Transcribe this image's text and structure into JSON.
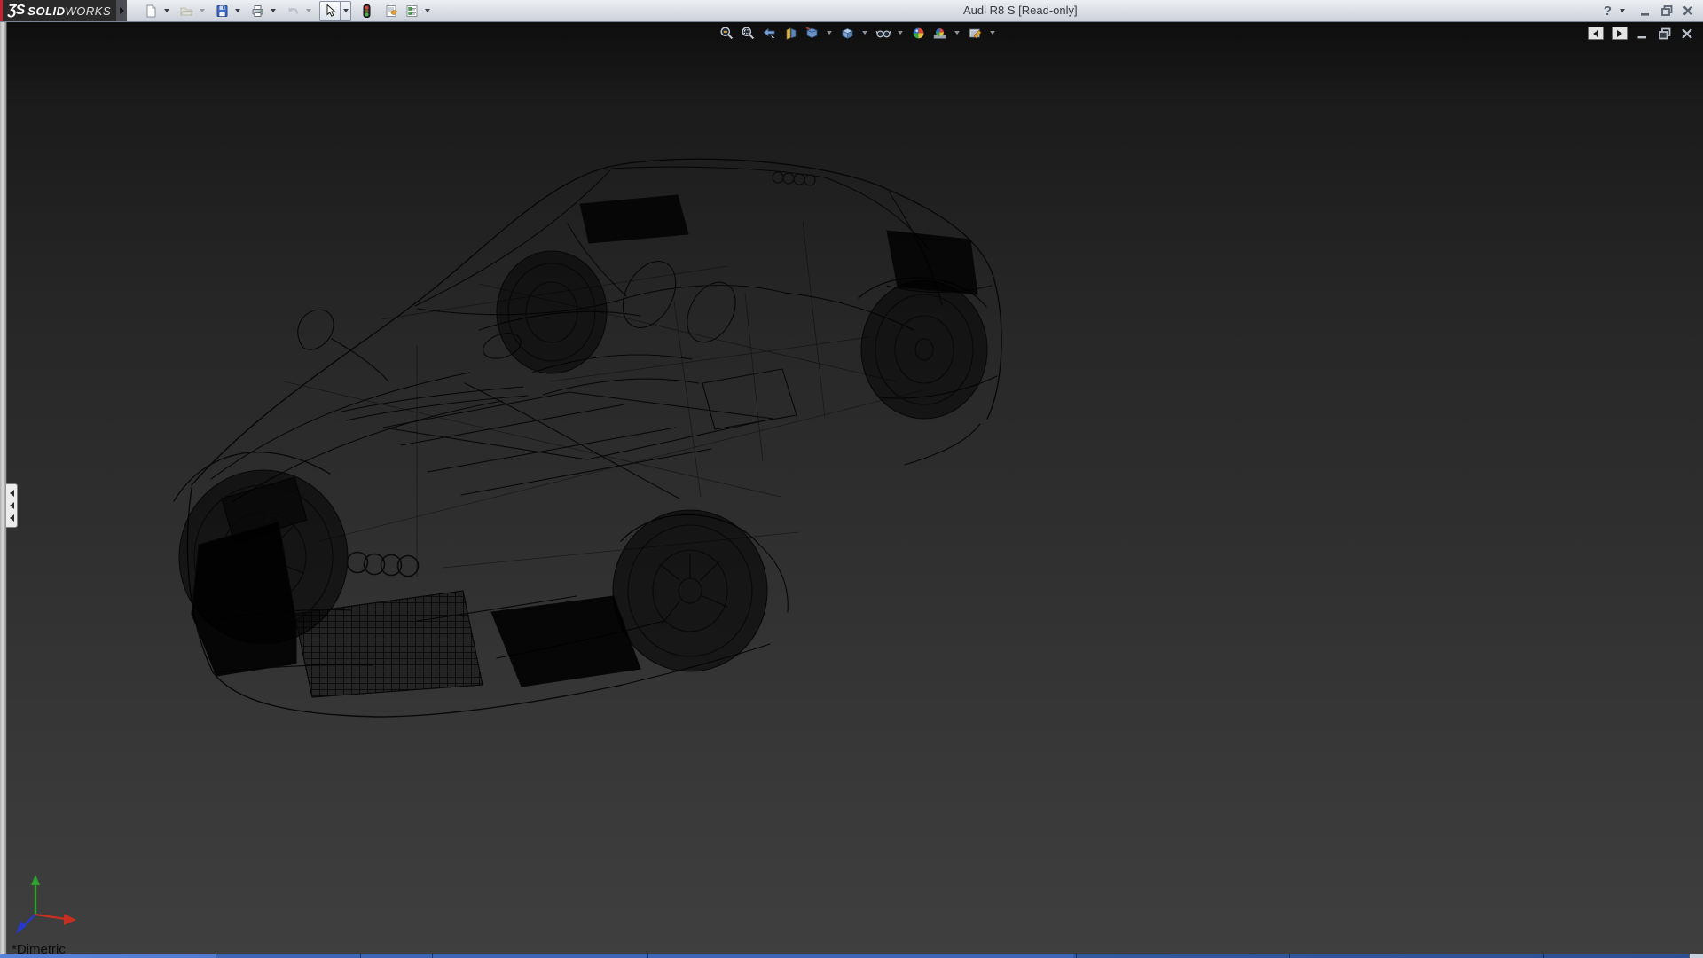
{
  "window": {
    "title": "Audi R8 S [Read-only]",
    "controls": {
      "help": "?",
      "minimize": "minimize",
      "restore": "restore",
      "close": "close"
    }
  },
  "brand": {
    "mark": "ƷS",
    "name_bold": "SOLID",
    "name_light": "WORKS"
  },
  "main_toolbar": {
    "items": [
      {
        "name": "new-document",
        "enabled": true,
        "has_dropdown": true
      },
      {
        "name": "open",
        "enabled": false,
        "has_dropdown": true
      },
      {
        "name": "save",
        "enabled": true,
        "has_dropdown": true
      },
      {
        "name": "print",
        "enabled": true,
        "has_dropdown": true
      },
      {
        "name": "undo",
        "enabled": false,
        "has_dropdown": true
      },
      {
        "name": "select",
        "enabled": true,
        "has_dropdown": true,
        "active": true
      },
      {
        "name": "rebuild-traffic-light",
        "enabled": true,
        "has_dropdown": false
      },
      {
        "name": "file-properties",
        "enabled": true,
        "has_dropdown": false
      },
      {
        "name": "options-checklist",
        "enabled": true,
        "has_dropdown": true
      }
    ]
  },
  "headsup_toolbar": {
    "items": [
      {
        "name": "zoom-to-fit",
        "has_dropdown": false
      },
      {
        "name": "zoom-to-area",
        "has_dropdown": false
      },
      {
        "name": "previous-view",
        "has_dropdown": false
      },
      {
        "name": "section-view",
        "has_dropdown": false
      },
      {
        "name": "view-orientation",
        "has_dropdown": true
      },
      {
        "name": "display-style",
        "has_dropdown": true
      },
      {
        "name": "hide-show-items",
        "has_dropdown": true
      },
      {
        "name": "edit-appearance",
        "has_dropdown": false
      },
      {
        "name": "apply-scene",
        "has_dropdown": true
      },
      {
        "name": "view-settings",
        "has_dropdown": true
      }
    ]
  },
  "document_window_controls": [
    "toggle-left-pane",
    "toggle-right-pane",
    "minimize",
    "restore",
    "close"
  ],
  "left_panel": {
    "state": "collapsed",
    "collapse_arrow_direction": "left",
    "collapse_arrow_count": 3
  },
  "viewport": {
    "status_view_label": "*Dimetric",
    "triad_axis_colors": {
      "x": "#c62f22",
      "y": "#2da12d",
      "z": "#2838c8"
    }
  },
  "colors": {
    "brand_red": "#c8232c",
    "titlebar_top": "#eceff3",
    "titlebar_bottom": "#ccd1d9",
    "viewport_top": "#0e0e0e",
    "viewport_bottom": "#3f3f3f",
    "taskbar_blue": "#3c67b8",
    "wireframe_line": "#080808"
  }
}
